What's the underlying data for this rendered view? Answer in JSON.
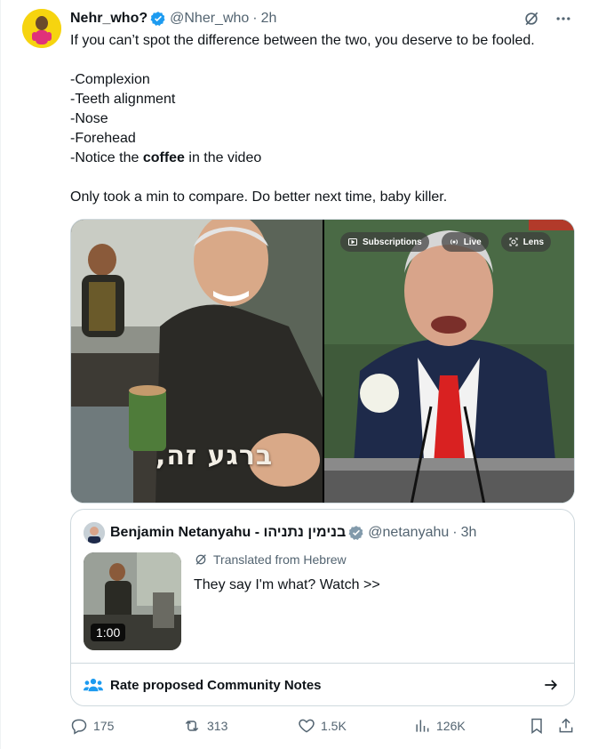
{
  "tweet": {
    "author_name": "Nehr_who?",
    "handle": "@Nher_who",
    "separator": "·",
    "time": "2h",
    "text_lines": [
      "If you can’t spot the difference between the two, you deserve to be fooled.",
      "",
      "-Complexion",
      "-Teeth alignment",
      "-Nose",
      "-Forehead",
      "-Notice the",
      "",
      "Only took a min to compare. Do better next time, baby killer."
    ],
    "bold_word": "coffee",
    "bold_suffix": " in the video"
  },
  "media": {
    "left_caption": "ברגע זה,",
    "overlay_buttons": [
      "Subscriptions",
      "Live",
      "Lens"
    ]
  },
  "quote": {
    "author_name": "Benjamin Netanyahu - בנימין נתניהו",
    "handle": "@netanyahu",
    "separator": "·",
    "time": "3h",
    "translated_label": "Translated from Hebrew",
    "text": "They say I'm what? Watch >>",
    "video_duration": "1:00"
  },
  "community_notes": {
    "label": "Rate proposed Community Notes"
  },
  "actions": {
    "replies": "175",
    "reposts": "313",
    "likes": "1.5K",
    "views": "126K"
  },
  "colors": {
    "verified": "#1d9bf0",
    "text_secondary": "#536471",
    "border": "#cfd9de",
    "avatar_bg": "#f6d40f",
    "notes_icon": "#1d9bf0"
  },
  "icons": [
    "verified-badge-icon",
    "grok-icon",
    "more-icon",
    "translate-icon",
    "community-notes-icon",
    "arrow-right-icon",
    "reply-icon",
    "repost-icon",
    "like-icon",
    "views-icon",
    "bookmark-icon",
    "share-icon"
  ]
}
